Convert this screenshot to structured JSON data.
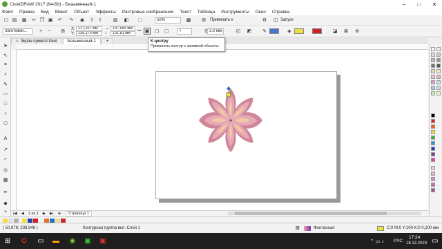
{
  "window": {
    "title": "CorelDRAW 2017 (64-Bit) - Безымянный-1",
    "minimize": "–",
    "maximize": "□",
    "close": "✕"
  },
  "menu": [
    "Файл",
    "Правка",
    "Вид",
    "Макет",
    "Объект",
    "Эффекты",
    "Растровые изображения",
    "Текст",
    "Таблица",
    "Инструменты",
    "Окно",
    "Справка"
  ],
  "toolbar1": {
    "zoom": "50%",
    "snap_label": "Привязать к",
    "launch_label": "Запуск"
  },
  "toolbar2": {
    "preset": "Заготовки...",
    "x": "117,267 мм",
    "y": "136,175 мм",
    "w": "147,656 мм",
    "h": "131,81 мм",
    "lock_hint": "мм",
    "step": "4",
    "outline_width": "3,0 мм"
  },
  "tabs": [
    "Экран приветствия",
    "Безымянный-1"
  ],
  "tooltip": {
    "title": "К центру",
    "text": "Применить контур с заливкой объекта."
  },
  "pagebar": {
    "page_count": "1 из 1",
    "page_tab": "Страница 1"
  },
  "status": {
    "coords": "( 50,978; 238,948 )",
    "object_info": "Контурная группа вкл. Слой 1",
    "fill_label": "Фонтанная",
    "color_info": "C:0 M:0 Y:100 K:0  0,200 мм"
  },
  "taskbar": {
    "lang": "РУС",
    "time": "17:24",
    "date": "18.12.2020"
  },
  "colors": {
    "accent": "#1e73be",
    "flower_outer": "#c97b8f",
    "flower_fill": "#e7a9b6",
    "flower_inner": "#f3d0a0",
    "page_bg": "#ffffff",
    "taskbar_bg": "#1f1f1f"
  }
}
